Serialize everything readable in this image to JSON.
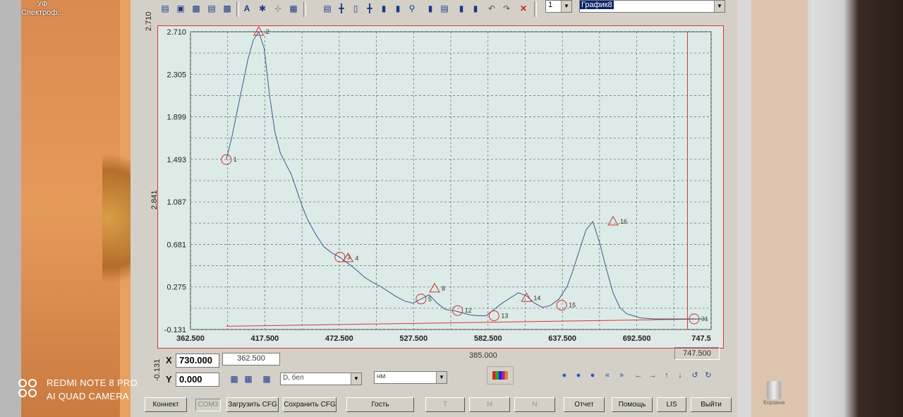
{
  "desktop": {
    "icon_label_line1": "УФ",
    "icon_label_line2": "Спектроф..."
  },
  "watermark": {
    "line1": "REDMI NOTE 8 PRO",
    "line2": "AI QUAD CAMERA"
  },
  "recycle_bin_label": "Корзина",
  "toolbar": {
    "combo_number": "1",
    "combo_graph": "График8"
  },
  "side": {
    "top_value": "2.710",
    "mid_value": "2.841",
    "bottom_value": "-0.131"
  },
  "chart_data": {
    "type": "line",
    "y_ticks": [
      "2.710",
      "2.305",
      "1.899",
      "1.493",
      "1.087",
      "0.681",
      "0.275",
      "-0.131"
    ],
    "x_ticks": [
      "362.500",
      "417.500",
      "472.500",
      "527.500",
      "582.500",
      "637.500",
      "692.500",
      "747.5"
    ],
    "xlim": [
      362.5,
      747.5
    ],
    "ylim": [
      -0.131,
      2.71
    ],
    "grid": true,
    "x": [
      389,
      393,
      397,
      401,
      405,
      409,
      413,
      417,
      421,
      425,
      429,
      433,
      437,
      441,
      445,
      449,
      455,
      461,
      467,
      473,
      479,
      485,
      491,
      497,
      503,
      509,
      515,
      521,
      527,
      533,
      539,
      545,
      551,
      557,
      563,
      569,
      575,
      581,
      587,
      593,
      599,
      605,
      611,
      617,
      623,
      629,
      635,
      641,
      645,
      650,
      655,
      660,
      665,
      670,
      675,
      680,
      685,
      690,
      695,
      705,
      715,
      725,
      735,
      745
    ],
    "y": [
      1.49,
      1.7,
      1.95,
      2.2,
      2.45,
      2.63,
      2.71,
      2.55,
      2.1,
      1.75,
      1.55,
      1.45,
      1.35,
      1.2,
      1.05,
      0.92,
      0.78,
      0.66,
      0.6,
      0.56,
      0.5,
      0.44,
      0.37,
      0.32,
      0.28,
      0.23,
      0.18,
      0.14,
      0.12,
      0.16,
      0.2,
      0.12,
      0.06,
      0.05,
      0.03,
      0.01,
      0.0,
      0.0,
      0.06,
      0.12,
      0.17,
      0.22,
      0.19,
      0.12,
      0.08,
      0.1,
      0.16,
      0.28,
      0.42,
      0.62,
      0.82,
      0.9,
      0.7,
      0.45,
      0.22,
      0.08,
      0.02,
      0.0,
      -0.02,
      -0.03,
      -0.03,
      -0.03,
      -0.03,
      -0.03
    ],
    "baseline": {
      "x": [
        389,
        745
      ],
      "y": [
        -0.1,
        -0.03
      ]
    },
    "cursor_x": 730,
    "markers": [
      {
        "label": "1",
        "shape": "circle",
        "x": 389,
        "y": 1.49
      },
      {
        "label": "2",
        "shape": "triangle",
        "x": 413,
        "y": 2.71
      },
      {
        "label": "3",
        "shape": "circle",
        "x": 473,
        "y": 0.56
      },
      {
        "label": "4",
        "shape": "triangle",
        "x": 479,
        "y": 0.55
      },
      {
        "label": "5",
        "shape": "circle",
        "x": 533,
        "y": 0.16
      },
      {
        "label": "8",
        "shape": "triangle",
        "x": 543,
        "y": 0.26
      },
      {
        "label": "12",
        "shape": "circle",
        "x": 560,
        "y": 0.05
      },
      {
        "label": "13",
        "shape": "circle",
        "x": 587,
        "y": 0.0
      },
      {
        "label": "14",
        "shape": "triangle",
        "x": 611,
        "y": 0.17
      },
      {
        "label": "15",
        "shape": "circle",
        "x": 637,
        "y": 0.1
      },
      {
        "label": "16",
        "shape": "triangle",
        "x": 675,
        "y": 0.9
      },
      {
        "label": "31",
        "shape": "circle",
        "x": 735,
        "y": -0.03
      }
    ]
  },
  "coords": {
    "x_label": "X",
    "x_value": "730.000",
    "y_label": "Y",
    "y_value": "0.000",
    "x_start": "362.500",
    "x_span": "385.000",
    "x_end": "747.500"
  },
  "selects": {
    "mode": "D, бел",
    "units": "нм"
  },
  "buttons": {
    "connect": "Коннект",
    "port": "COM3",
    "load_cfg": "Загрузить CFG",
    "save_cfg": "Сохранить CFG",
    "guest": "Гость",
    "t": "T",
    "m": "M",
    "n": "N",
    "report": "Отчет",
    "help": "Помощь",
    "lis": "LIS",
    "exit": "Выйти"
  }
}
